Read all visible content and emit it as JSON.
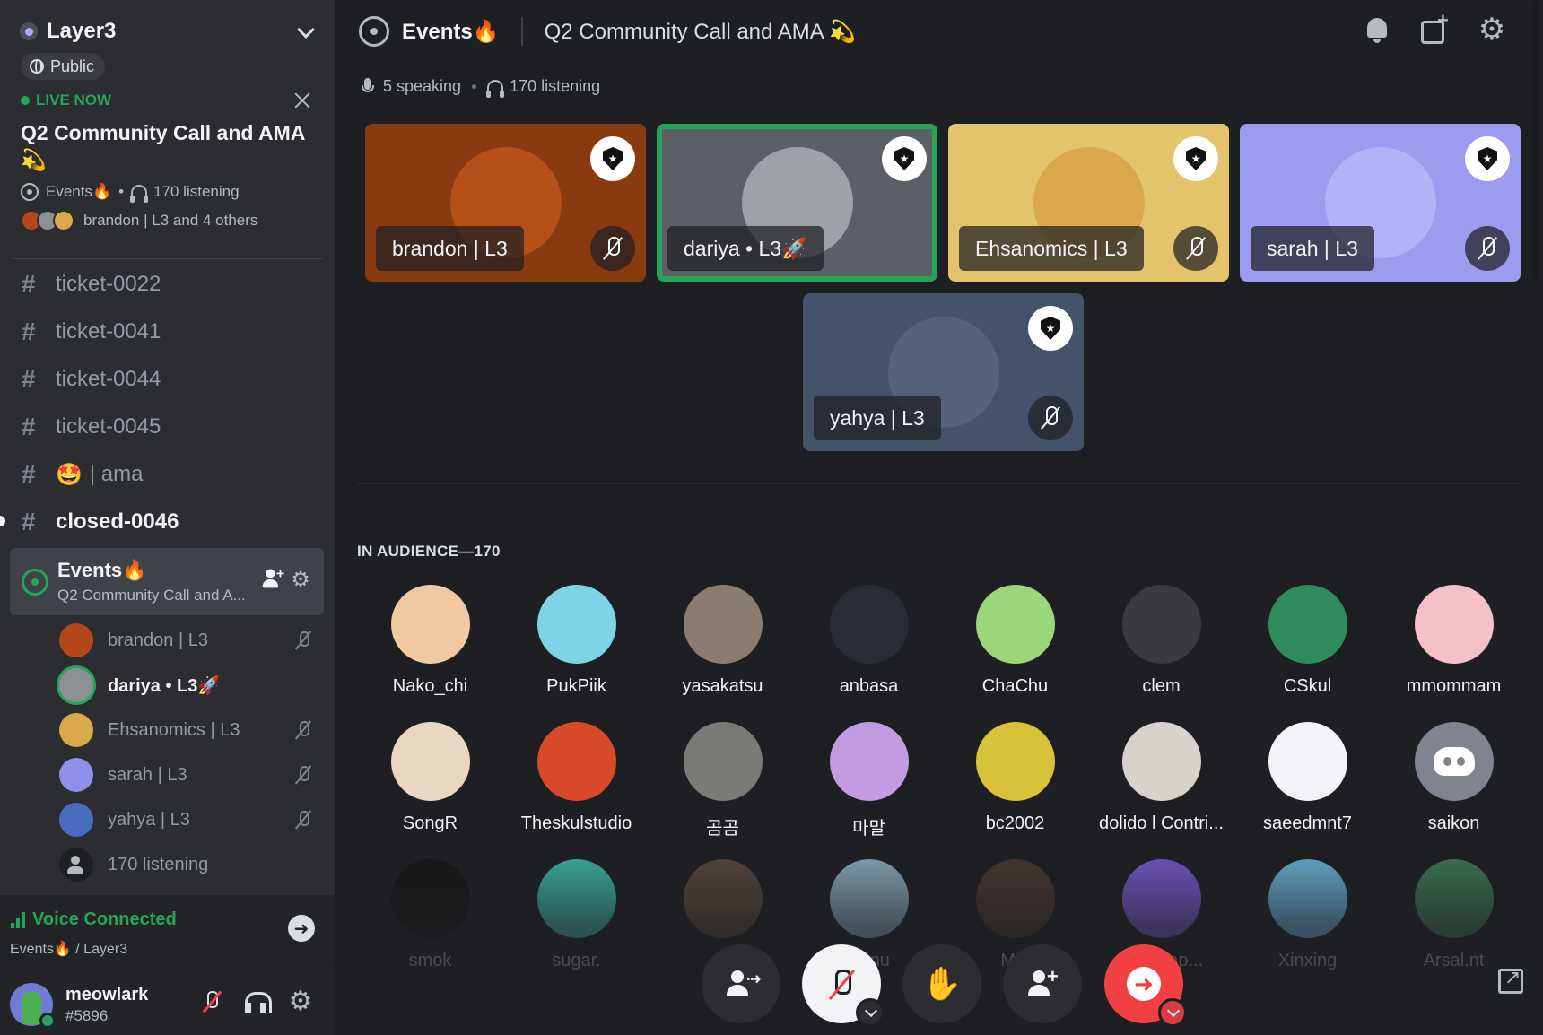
{
  "server": {
    "name": "Layer3",
    "visibility": "Public"
  },
  "live_event": {
    "status": "LIVE NOW",
    "title": "Q2 Community Call and AMA 💫",
    "channel": "Events🔥",
    "listening": "170 listening",
    "speakers_summary": "brandon | L3 and 4 others"
  },
  "channels": [
    {
      "name": "ticket-0022",
      "unread": false
    },
    {
      "name": "ticket-0041",
      "unread": false
    },
    {
      "name": "ticket-0044",
      "unread": false
    },
    {
      "name": "ticket-0045",
      "unread": false
    },
    {
      "name": "| ama",
      "emoji": "🤩",
      "unread": false
    },
    {
      "name": "closed-0046",
      "unread": true
    }
  ],
  "stage_channel": {
    "name": "Events🔥",
    "subtitle": "Q2 Community Call and A..."
  },
  "stage_members": [
    {
      "name": "brandon | L3",
      "color": "#b5471b",
      "speaking": false,
      "muted": true
    },
    {
      "name": "dariya • L3🚀",
      "color": "#8c8f94",
      "speaking": true,
      "muted": false
    },
    {
      "name": "Ehsanomics | L3",
      "color": "#d9a84a",
      "speaking": false,
      "muted": true
    },
    {
      "name": "sarah | L3",
      "color": "#8f8ee8",
      "speaking": false,
      "muted": true
    },
    {
      "name": "yahya | L3",
      "color": "#4a6cbf",
      "speaking": false,
      "muted": true
    }
  ],
  "listening_row": "170 listening",
  "voice": {
    "status": "Voice Connected",
    "location": "Events🔥 / Layer3"
  },
  "user": {
    "name": "meowlark",
    "tag": "#5896"
  },
  "topbar": {
    "title": "Events🔥",
    "topic": "Q2 Community Call and AMA 💫"
  },
  "stats": {
    "speaking": "5 speaking",
    "listening": "170 listening"
  },
  "speakers": [
    {
      "name": "brandon | L3",
      "bg": "#8a3a10",
      "avatar": "#b5501a"
    },
    {
      "name": "dariya • L3🚀",
      "bg": "#5c5f66",
      "avatar": "#9ea1a6"
    },
    {
      "name": "Ehsanomics | L3",
      "bg": "#e3c36b",
      "avatar": "#d9a84a"
    },
    {
      "name": "sarah | L3",
      "bg": "#9c9bf0",
      "avatar": "#b3b2f7"
    },
    {
      "name": "yahya | L3",
      "bg": "#46526a",
      "avatar": "#56627a"
    }
  ],
  "audience": {
    "header": "IN AUDIENCE—170",
    "members": [
      {
        "name": "Nako_chi",
        "color": "#f0c9a0"
      },
      {
        "name": "PukPiik",
        "color": "#7fd3e6"
      },
      {
        "name": "yasakatsu",
        "color": "#8a7d70"
      },
      {
        "name": "anbasa",
        "color": "#2a2c33"
      },
      {
        "name": "ChaChu",
        "color": "#9bd67a"
      },
      {
        "name": "clem",
        "color": "#3a3b3f"
      },
      {
        "name": "CSkul",
        "color": "#2f8a5e"
      },
      {
        "name": "mmommam",
        "color": "#f6c0c8"
      },
      {
        "name": "SongR",
        "color": "#e9d7c2"
      },
      {
        "name": "Theskulstudio",
        "color": "#d94a2a"
      },
      {
        "name": "곰곰",
        "color": "#7a7a76"
      },
      {
        "name": "마말",
        "color": "#c39be0"
      },
      {
        "name": "bc2002",
        "color": "#d8c23a"
      },
      {
        "name": "dolido l Contri...",
        "color": "#d8d2cc"
      },
      {
        "name": "saeedmnt7",
        "color": "#f5f3f7"
      },
      {
        "name": "saikon",
        "color": "#80848e"
      },
      {
        "name": "smok",
        "color": "#151515"
      },
      {
        "name": "sugar.",
        "color": "#3fbcb0"
      },
      {
        "name": "",
        "color": "#5b4a3e"
      },
      {
        "name": "Kanu",
        "color": "#8fb4c8"
      },
      {
        "name": "Mal",
        "color": "#4a3a34"
      },
      {
        "name": "W... Rap...",
        "color": "#7a5cd6"
      },
      {
        "name": "Xinxing",
        "color": "#6fb8e0"
      },
      {
        "name": "Arsal.nt",
        "color": "#3f7d5a"
      }
    ]
  },
  "controls": {
    "move_audience": "move-to-audience",
    "mute": "unmute",
    "raise_hand": "raise-hand",
    "invite": "invite",
    "leave": "leave"
  }
}
